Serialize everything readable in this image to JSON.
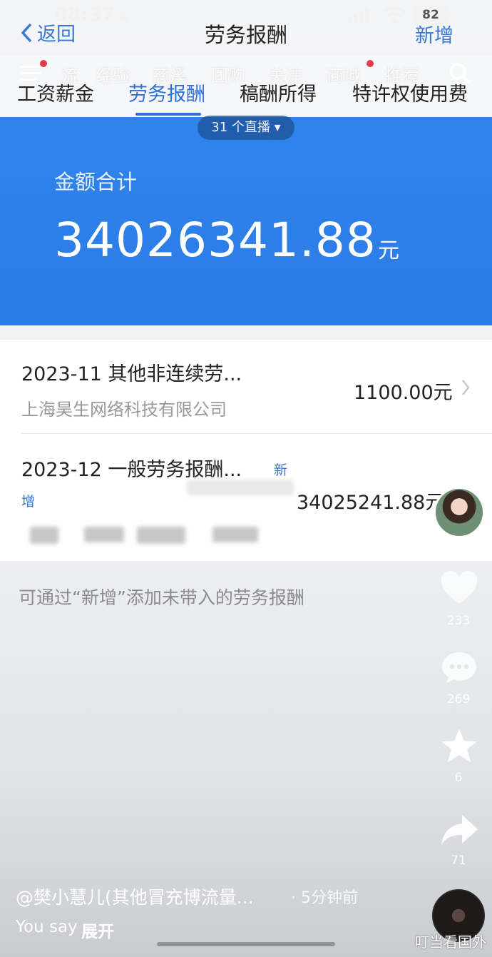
{
  "status_bar": {
    "time": "08:37",
    "battery": "82"
  },
  "nav": {
    "back_label": "返回",
    "title": "劳务报酬",
    "add_label": "新增"
  },
  "overlay_nav": {
    "items": [
      "流",
      "经验",
      "慈溪",
      "团购",
      "关注",
      "商城",
      "推荐"
    ]
  },
  "tabs": [
    {
      "label": "工资薪金",
      "active": false
    },
    {
      "label": "劳务报酬",
      "active": true
    },
    {
      "label": "稿酬所得",
      "active": false
    },
    {
      "label": "特许权使用费",
      "active": false
    }
  ],
  "live_chip": "31 个直播 ▾",
  "summary": {
    "label": "金额合计",
    "value": "34026341.88",
    "unit": "元"
  },
  "records": [
    {
      "title": "2023-11 其他非连续劳...",
      "company": "上海昊生网络科技有限公司",
      "amount": "1100.00元"
    },
    {
      "title": "2023-12 一般劳务报酬...",
      "badge_a": "新",
      "badge_b": "增",
      "amount": "34025241.88元"
    }
  ],
  "hint": "可通过“新增”添加未带入的劳务报酬",
  "side_actions": {
    "like_count": "233",
    "comment_count": "269",
    "favorite_count": "6",
    "share_count": "71"
  },
  "caption": {
    "author": "@樊小慧儿(其他冒充博流量...",
    "time_ago": "· 5分钟前",
    "you_say": "You say",
    "expand": "展开"
  },
  "watermark": "叮当看国外",
  "colors": {
    "accent_blue": "#2f6fd6",
    "banner_blue": "#2f84ea"
  }
}
